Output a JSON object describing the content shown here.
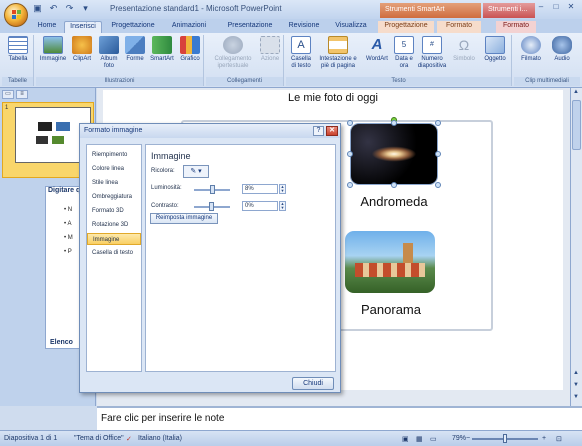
{
  "window": {
    "title": "Presentazione standard1 - Microsoft PowerPoint",
    "tools_smartart": "Strumenti SmartArt",
    "tools_image": "Strumenti i...",
    "controls": [
      "–",
      "□",
      "✕"
    ]
  },
  "tabs": [
    "Home",
    "Inserisci",
    "Progettazione",
    "Animazioni",
    "Presentazione",
    "Revisione",
    "Visualizza",
    "Progettazione",
    "Formato",
    "Formato"
  ],
  "ribbon": {
    "groups": [
      "Tabelle",
      "Illustrazioni",
      "Collegamenti",
      "Testo",
      "Clip multimediali"
    ],
    "buttons": {
      "tabella": "Tabella",
      "immagine": "Immagine",
      "clipart": "ClipArt",
      "album": "Album foto",
      "forme": "Forme",
      "smartart": "SmartArt",
      "grafico": "Grafico",
      "collegamento": "Collegamento ipertestuale",
      "azione": "Azione",
      "casella": "Casella di testo",
      "intestazione": "Intestazione e piè di pagina",
      "wordart": "WordArt",
      "data": "Data e ora",
      "numero": "Numero diapositiva",
      "simbolo": "Simbolo",
      "oggetto": "Oggetto",
      "filmato": "Filmato",
      "audio": "Audio"
    }
  },
  "left_pane": {
    "slide_number": "1",
    "text_pane_title": "Digitare q",
    "bullets": [
      "•",
      "•",
      "•",
      "•"
    ],
    "bullet_initials": [
      "N",
      "A",
      "M",
      "P"
    ],
    "bottom_label": "Elenco"
  },
  "slide": {
    "title": "Le mie foto di oggi",
    "captions": [
      "Andromeda",
      "Panorama"
    ]
  },
  "notes": {
    "placeholder": "Fare clic per inserire le note"
  },
  "status": {
    "slide_info": "Diapositiva 1 di 1",
    "theme": "\"Tema di Office\"",
    "language": "Italiano (Italia)",
    "zoom": "79%"
  },
  "dialog": {
    "title": "Formato immagine",
    "help": "?",
    "close": "✕",
    "nav_items": [
      "Riempimento",
      "Colore linea",
      "Stile linea",
      "Ombreggiatura",
      "Formato 3D",
      "Rotazione 3D",
      "Immagine",
      "Casella di testo"
    ],
    "selected_nav_index": 6,
    "panel_title": "Immagine",
    "recolor_label": "Ricolora:",
    "brightness_label": "Luminosità:",
    "brightness_value": "8%",
    "contrast_label": "Contrasto:",
    "contrast_value": "0%",
    "reset_button": "Reimposta immagine",
    "close_button": "Chiudi"
  }
}
